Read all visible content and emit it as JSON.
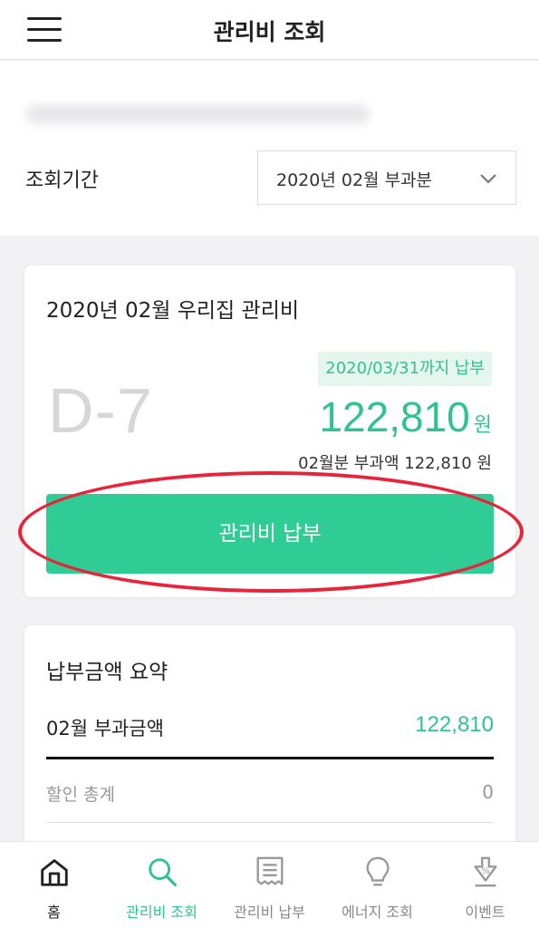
{
  "header": {
    "title": "관리비 조회",
    "menu_icon": "hamburger-menu-icon"
  },
  "period": {
    "label": "조회기간",
    "selected": "2020년 02월 부과분",
    "dropdown_icon": "chevron-down-icon"
  },
  "bill": {
    "title": "2020년 02월 우리집 관리비",
    "dday": "D-7",
    "due_badge": "2020/03/31까지 납부",
    "amount": "122,810",
    "amount_unit": "원",
    "billed_line": "02월분 부과액 122,810 원",
    "pay_button": "관리비 납부"
  },
  "summary": {
    "title": "납부금액 요약",
    "charge_label": "02월 부과금액",
    "charge_value": "122,810",
    "discount_label": "할인 총계",
    "discount_value": "0"
  },
  "bottom_nav": {
    "items": [
      {
        "label": "홈",
        "icon": "home-icon"
      },
      {
        "label": "관리비 조회",
        "icon": "search-icon",
        "active": true
      },
      {
        "label": "관리비 납부",
        "icon": "receipt-icon"
      },
      {
        "label": "에너지 조회",
        "icon": "lightbulb-icon"
      },
      {
        "label": "이벤트",
        "icon": "discount-event-icon"
      }
    ]
  },
  "colors": {
    "accent": "#2fc48f",
    "button": "#2fcd95",
    "highlight": "#e8243b",
    "badge_bg": "#e4f6ee"
  }
}
